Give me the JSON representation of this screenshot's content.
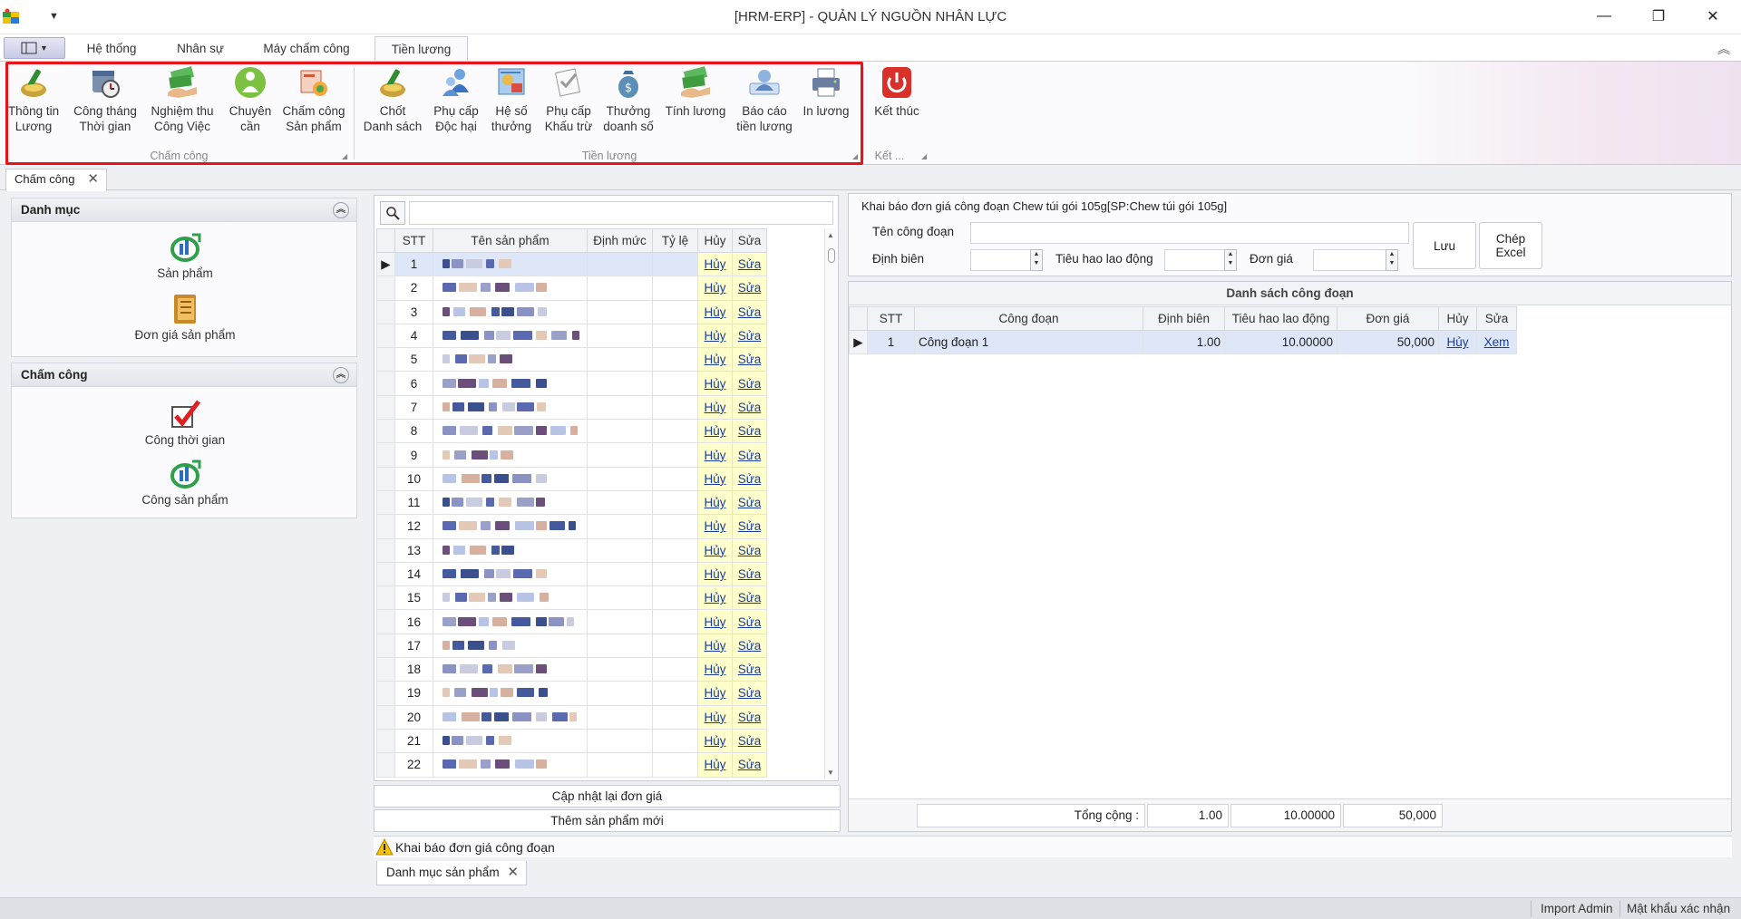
{
  "window": {
    "title": "[HRM-ERP] - QUẢN LÝ NGUỒN NHÂN LỰC",
    "minimize": "—",
    "restore": "❐",
    "close": "✕"
  },
  "ribbon_tabs": [
    {
      "label": "Hệ thống",
      "active": false
    },
    {
      "label": "Nhân sự",
      "active": false
    },
    {
      "label": "Máy chấm công",
      "active": false
    },
    {
      "label": "Tiền lương",
      "active": true
    }
  ],
  "ribbon_groups": [
    {
      "label": "Chấm công",
      "buttons": [
        {
          "line1": "Thông tin",
          "line2": "Lương",
          "icon": "brush-icon"
        },
        {
          "line1": "Công tháng",
          "line2": "Thời gian",
          "icon": "clock-calendar-icon"
        },
        {
          "line1": "Nghiệm thu",
          "line2": "Công Việc",
          "icon": "money-hand-icon"
        },
        {
          "line1": "Chuyên",
          "line2": "cần",
          "icon": "person-icon"
        },
        {
          "line1": "Chấm công",
          "line2": "Sản phẩm",
          "icon": "product-report-icon"
        }
      ]
    },
    {
      "label": "Tiền lương",
      "buttons": [
        {
          "line1": "Chốt",
          "line2": "Danh sách",
          "icon": "brush-icon"
        },
        {
          "line1": "Phụ cấp",
          "line2": "Độc hại",
          "icon": "users-icon"
        },
        {
          "line1": "Hệ số",
          "line2": "thưởng",
          "icon": "award-icon"
        },
        {
          "line1": "Phụ cấp",
          "line2": "Khấu trừ",
          "icon": "checklist-icon"
        },
        {
          "line1": "Thưởng",
          "line2": "doanh số",
          "icon": "money-bag-icon"
        },
        {
          "line1": "Tính lương",
          "line2": "",
          "icon": "money-hand-icon"
        },
        {
          "line1": "Báo cáo",
          "line2": "tiền lương",
          "icon": "user-report-icon"
        },
        {
          "line1": "In lương",
          "line2": "",
          "icon": "printer-icon"
        }
      ]
    },
    {
      "label": "Kết ...",
      "buttons": [
        {
          "line1": "Kết thúc",
          "line2": "",
          "icon": "power-icon"
        }
      ]
    }
  ],
  "document_tab": "Chấm công",
  "left_nav": {
    "groups": [
      {
        "title": "Danh mục",
        "items": [
          "Sản phẩm",
          "Đơn giá sản phẩm"
        ]
      },
      {
        "title": "Chấm công",
        "items": [
          "Công thời gian",
          "Công sản phẩm"
        ]
      }
    ]
  },
  "product_grid": {
    "search_placeholder": "",
    "columns": [
      "STT",
      "Tên sản phẩm",
      "Định mức",
      "Tỷ lệ",
      "Hủy",
      "Sửa"
    ],
    "row_numbers": [
      "1",
      "2",
      "3",
      "4",
      "5",
      "6",
      "7",
      "8",
      "9",
      "10",
      "11",
      "12",
      "13",
      "14",
      "15",
      "16",
      "17",
      "18",
      "19",
      "20",
      "21",
      "22"
    ],
    "cancel_label": "Hủy",
    "edit_label": "Sửa",
    "selected_row": 1
  },
  "buttons": {
    "update_price": "Cập nhật lại đơn giá",
    "add_product": "Thêm sản phẩm mới",
    "save": "Lưu",
    "export_line1": "Chép",
    "export_line2": "Excel"
  },
  "stage_form": {
    "title": "Khai báo đơn giá công đoạn Chew túi gói 105g[SP:Chew túi gói 105g]",
    "stage_name_label": "Tên công đoạn",
    "staffing_label": "Định biên",
    "labor_label": "Tiêu hao lao động",
    "unit_price_label": "Đơn giá",
    "stage_name_value": "",
    "staffing_value": "",
    "labor_value": "",
    "unit_price_value": ""
  },
  "stage_list": {
    "title": "Danh sách công đoạn",
    "columns": [
      "STT",
      "Công đoạn",
      "Định biên",
      "Tiêu hao lao động",
      "Đơn giá",
      "Hủy",
      "Sửa"
    ],
    "rows": [
      {
        "stt": "1",
        "name": "Công đoạn 1",
        "staffing": "1.00",
        "labor": "10.00000",
        "price": "50,000",
        "cancel": "Hủy",
        "view": "Xem"
      }
    ],
    "total_label": "Tổng cộng :",
    "total_staffing": "1.00",
    "total_labor": "10.00000",
    "total_price": "50,000"
  },
  "warning": "Khai báo đơn giá công đoạn",
  "bottom_tab": "Danh mục sản phẩm",
  "status": {
    "import": "Import Admin",
    "password": "Mật khẩu xác nhận"
  }
}
